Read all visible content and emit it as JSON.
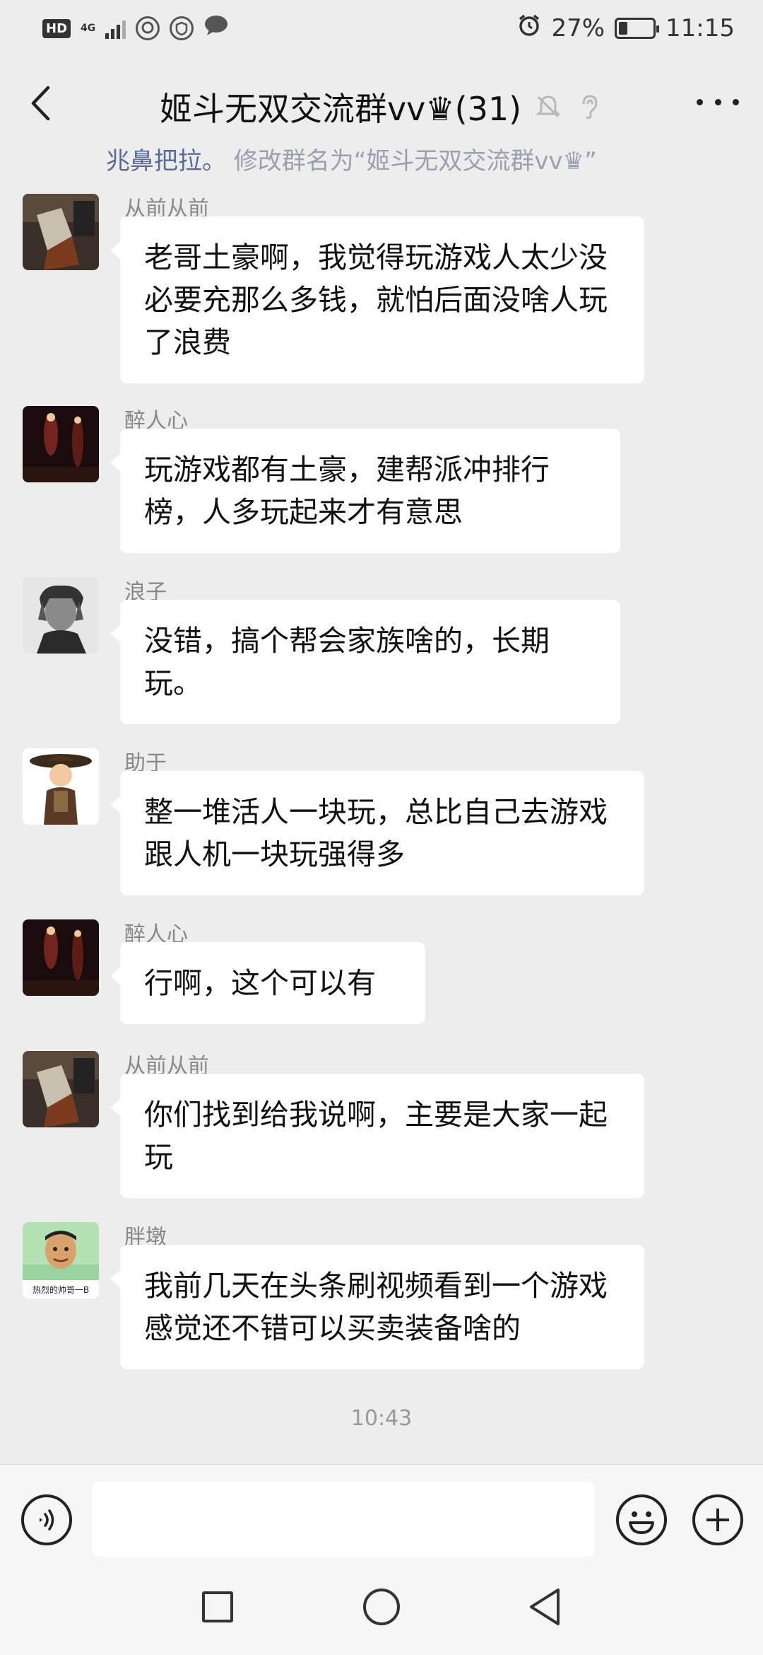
{
  "status_bar": {
    "hd": "HD",
    "network": "4G",
    "battery_text": "27%",
    "battery_level": 0.27,
    "time": "11:15",
    "icons": [
      "hd-icon",
      "signal-icon",
      "qq-icon",
      "shield-icon",
      "chat-icon",
      "alarm-icon",
      "battery-icon"
    ]
  },
  "header": {
    "title": "姬斗无双交流群vv♛(31)",
    "icons": [
      "back-icon",
      "mute-bell-icon",
      "ear-icon",
      "more-icon"
    ]
  },
  "system_notice": {
    "name": "兆鼻把拉。",
    "text": " 修改群名为“姬斗无双交流群vv♛”"
  },
  "messages": [
    {
      "sender": "从前从前",
      "text": "老哥土豪啊，我觉得玩游戏人太少没必要充那么多钱，就怕后面没啥人玩了浪费",
      "avatar": "dark-photo"
    },
    {
      "sender": "醉人心",
      "text": "玩游戏都有土豪，建帮派冲排行榜，人多玩起来才有意思",
      "avatar": "red-lights"
    },
    {
      "sender": "浪子",
      "text": "没错，搞个帮会家族啥的，长期玩。",
      "avatar": "bw-man"
    },
    {
      "sender": "助于",
      "text": "整一堆活人一块玩，总比自己去游戏跟人机一块玩强得多",
      "avatar": "cartoon-hat"
    },
    {
      "sender": "醉人心",
      "text": "行啊，这个可以有",
      "avatar": "red-lights"
    },
    {
      "sender": "从前从前",
      "text": "你们找到给我说啊，主要是大家一起玩",
      "avatar": "dark-photo"
    },
    {
      "sender": "胖墩",
      "text": "我前几天在头条刷视频看到一个游戏 感觉还不错可以买卖装备啥的",
      "avatar": "cartoon-face",
      "avatar_caption": "热烈的帅哥一B"
    }
  ],
  "time_label": "10:43",
  "input_bar": {
    "placeholder": "",
    "icons": [
      "voice-icon",
      "emoji-icon",
      "plus-icon"
    ]
  },
  "nav_bar": {
    "icons": [
      "recent-apps-icon",
      "home-icon",
      "back-nav-icon"
    ]
  }
}
